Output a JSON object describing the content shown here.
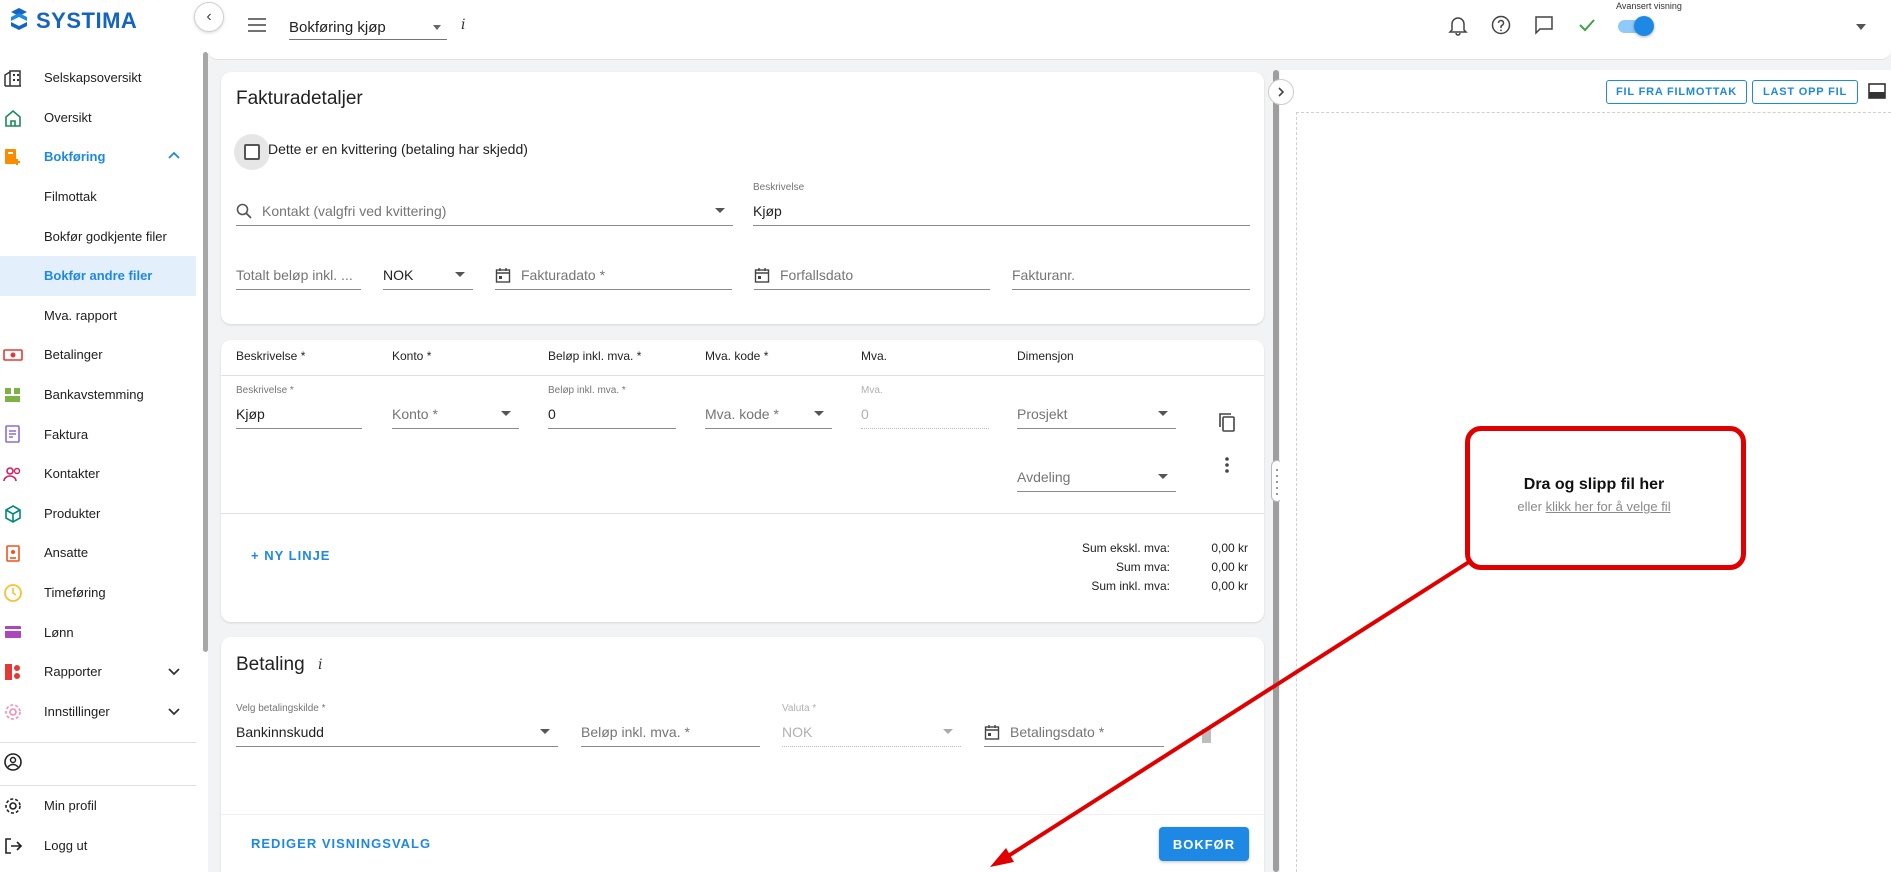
{
  "app": {
    "brand": "SYSTIMA",
    "brand_color": "#1565c0",
    "accent": "#1e88e5",
    "annotation_color": "#e10000"
  },
  "sidebar": {
    "items": [
      {
        "label": "Selskapsoversikt",
        "icon": "company-icon"
      },
      {
        "label": "Oversikt",
        "icon": "home-icon"
      },
      {
        "label": "Bokføring",
        "icon": "bookkeeping-icon",
        "expanded": true
      },
      {
        "label": "Filmottak",
        "sub": true
      },
      {
        "label": "Bokfør godkjente filer",
        "sub": true
      },
      {
        "label": "Bokfør andre filer",
        "sub": true,
        "selected": true
      },
      {
        "label": "Mva. rapport",
        "sub": true
      },
      {
        "label": "Betalinger",
        "icon": "payments-icon"
      },
      {
        "label": "Bankavstemming",
        "icon": "bank-reconciliation-icon"
      },
      {
        "label": "Faktura",
        "icon": "invoice-icon"
      },
      {
        "label": "Kontakter",
        "icon": "contacts-icon"
      },
      {
        "label": "Produkter",
        "icon": "products-icon"
      },
      {
        "label": "Ansatte",
        "icon": "employees-icon"
      },
      {
        "label": "Timeføring",
        "icon": "clock-icon"
      },
      {
        "label": "Lønn",
        "icon": "salary-icon"
      },
      {
        "label": "Rapporter",
        "icon": "reports-icon"
      },
      {
        "label": "Innstillinger",
        "icon": "settings-icon"
      }
    ],
    "bottom": {
      "profile": "Min profil",
      "logout": "Logg ut"
    }
  },
  "topbar": {
    "page_select": "Bokføring kjøp",
    "info": "i",
    "advanced_label": "Avansert visning",
    "advanced_on": true
  },
  "invoice": {
    "title": "Fakturadetaljer",
    "receipt_checkbox": "Dette er en kvittering (betaling har skjedd)",
    "contact_placeholder": "Kontakt (valgfri ved kvittering)",
    "description_label": "Beskrivelse",
    "description_value": "Kjøp",
    "total_placeholder": "Totalt beløp inkl. ...",
    "currency": "NOK",
    "invoice_date_placeholder": "Fakturadato *",
    "due_date_placeholder": "Forfallsdato",
    "invoice_no_placeholder": "Fakturanr."
  },
  "lines": {
    "headers": [
      "Beskrivelse *",
      "Konto *",
      "Beløp inkl. mva. *",
      "Mva. kode *",
      "Mva.",
      "Dimensjon"
    ],
    "row": {
      "desc_label": "Beskrivelse *",
      "desc_value": "Kjøp",
      "account_placeholder": "Konto *",
      "amount_label": "Beløp inkl. mva. *",
      "amount_value": "0",
      "vat_code_placeholder": "Mva. kode *",
      "vat_label": "Mva.",
      "vat_value": "0",
      "project_placeholder": "Prosjekt",
      "department_placeholder": "Avdeling"
    },
    "new_line": "+ NY LINJE",
    "sums": [
      {
        "label": "Sum ekskl. mva:",
        "value": "0,00 kr"
      },
      {
        "label": "Sum mva:",
        "value": "0,00 kr"
      },
      {
        "label": "Sum inkl. mva:",
        "value": "0,00 kr"
      }
    ]
  },
  "payment": {
    "title": "Betaling",
    "info": "i",
    "source_label": "Velg betalingskilde *",
    "source_value": "Bankinnskudd",
    "amount_placeholder": "Beløp inkl. mva. *",
    "currency_label": "Valuta *",
    "currency_value": "NOK",
    "date_placeholder": "Betalingsdato *"
  },
  "footer": {
    "edit_view": "REDIGER VISNINGSVALG",
    "submit": "BOKFØR"
  },
  "upload": {
    "from_inbox": "FIL FRA FILMOTTAK",
    "upload": "LAST OPP FIL",
    "drop_title": "Dra og slipp fil her",
    "drop_or": "eller",
    "drop_link": "klikk her for å velge fil"
  }
}
